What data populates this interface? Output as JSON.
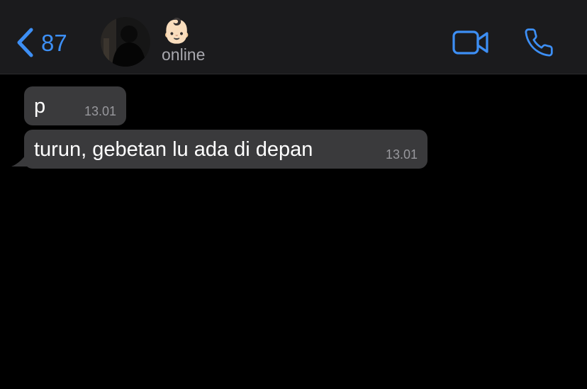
{
  "header": {
    "back_count": "87",
    "contact_name": "👶🏻",
    "contact_status": "online",
    "accent_color": "#3d8ff5"
  },
  "icons": {
    "back": "chevron-left-icon",
    "video": "video-camera-icon",
    "call": "phone-icon"
  },
  "messages": [
    {
      "text": "p",
      "time": "13.01"
    },
    {
      "text": "turun, gebetan lu ada di depan",
      "time": "13.01"
    }
  ]
}
